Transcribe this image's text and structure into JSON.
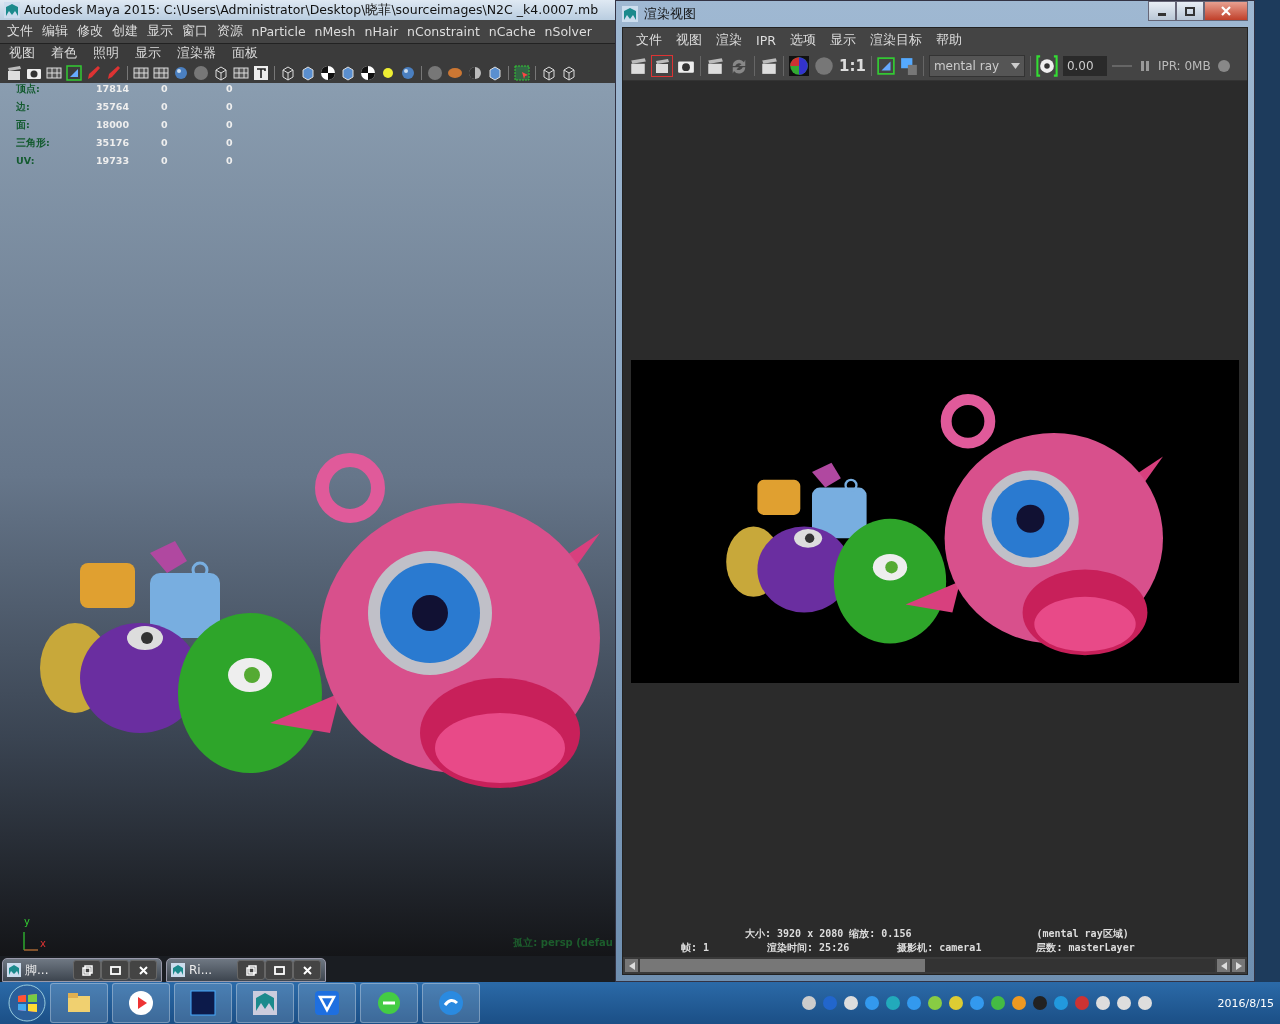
{
  "maya_window": {
    "title": "Autodesk Maya 2015: C:\\Users\\Administrator\\Desktop\\晓菲\\sourceimages\\N2C _k4.0007.mb",
    "menu": [
      "文件",
      "编辑",
      "修改",
      "创建",
      "显示",
      "窗口",
      "资源",
      "nParticle",
      "nMesh",
      "nHair",
      "nConstraint",
      "nCache",
      "nSolver"
    ],
    "panel_menu": [
      "视图",
      "着色",
      "照明",
      "显示",
      "渲染器",
      "面板"
    ],
    "stats": [
      {
        "label": "顶点:",
        "values": [
          "17814",
          "0",
          "0"
        ]
      },
      {
        "label": "边:",
        "values": [
          "35764",
          "0",
          "0"
        ]
      },
      {
        "label": "面:",
        "values": [
          "18000",
          "0",
          "0"
        ]
      },
      {
        "label": "三角形:",
        "values": [
          "35176",
          "0",
          "0"
        ]
      },
      {
        "label": "UV:",
        "values": [
          "19733",
          "0",
          "0"
        ]
      }
    ],
    "axis_labels": [
      "y",
      "x"
    ],
    "viewport_label": "孤立: persp (defau",
    "minimized_windows": [
      {
        "title": "脚..."
      },
      {
        "title": "Ri..."
      }
    ]
  },
  "render_window": {
    "title": "渲染视图",
    "menu": [
      "文件",
      "视图",
      "渲染",
      "IPR",
      "选项",
      "显示",
      "渲染目标",
      "帮助"
    ],
    "ratio": "1:1",
    "renderer": "mental ray",
    "exposure": "0.00",
    "ipr": "IPR: 0MB",
    "info": [
      [
        "大小: 3920 x 2080 缩放: 0.156",
        "(mental ray区域)"
      ],
      [
        "帧: 1",
        "渲染时间: 25:26",
        "摄影机: camera1",
        "层数: masterLayer"
      ]
    ]
  },
  "taskbar": {
    "date": "2016/8/15"
  }
}
